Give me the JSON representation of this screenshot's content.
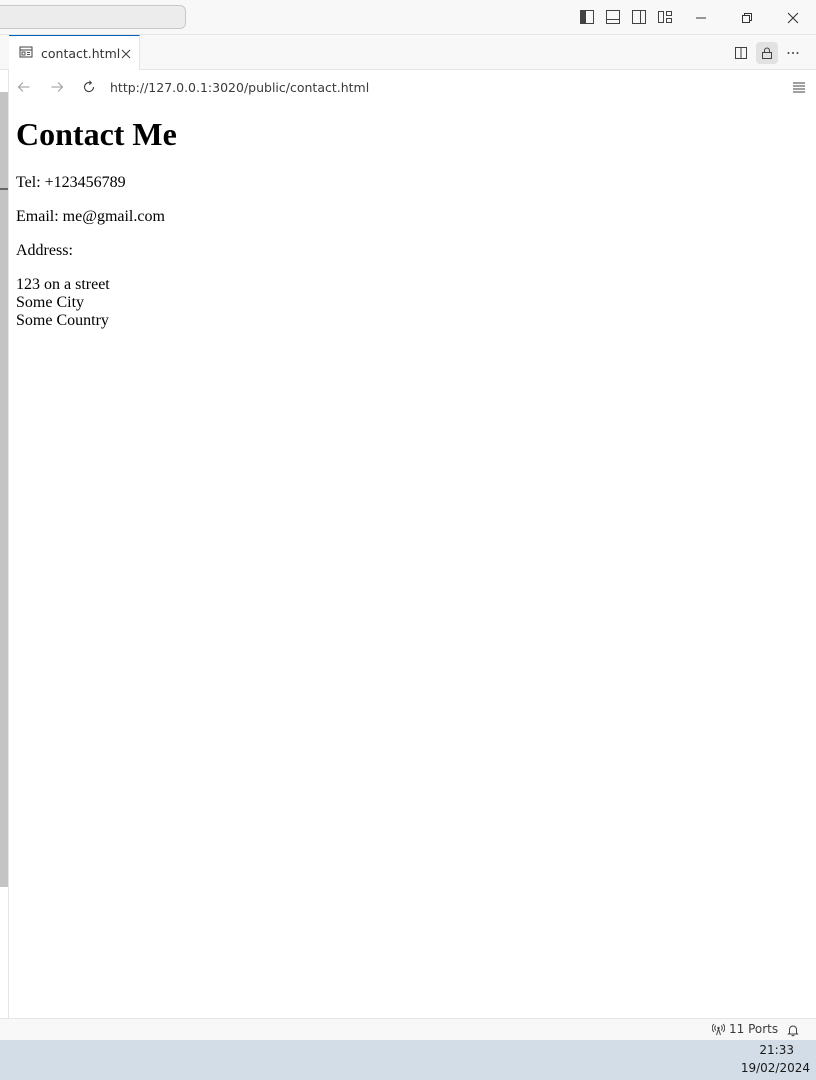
{
  "tab": {
    "label": "contact.html",
    "icon": "preview-icon",
    "close_icon": "close-icon"
  },
  "address_bar": {
    "url": "http://127.0.0.1:3020/public/contact.html"
  },
  "page": {
    "heading": "Contact Me",
    "tel": "Tel: +123456789",
    "email": "Email: me@gmail.com",
    "address_label": "Address:",
    "address_line1": "123 on a street",
    "address_line2": "Some City",
    "address_line3": "Some Country"
  },
  "status_bar": {
    "ports_label": "11 Ports"
  },
  "taskbar": {
    "time": "21:33",
    "date": "19/02/2024"
  },
  "colors": {
    "accent": "#005fb8",
    "chrome_bg": "#f8f8f8",
    "taskbar_bg": "#d3dde8"
  }
}
